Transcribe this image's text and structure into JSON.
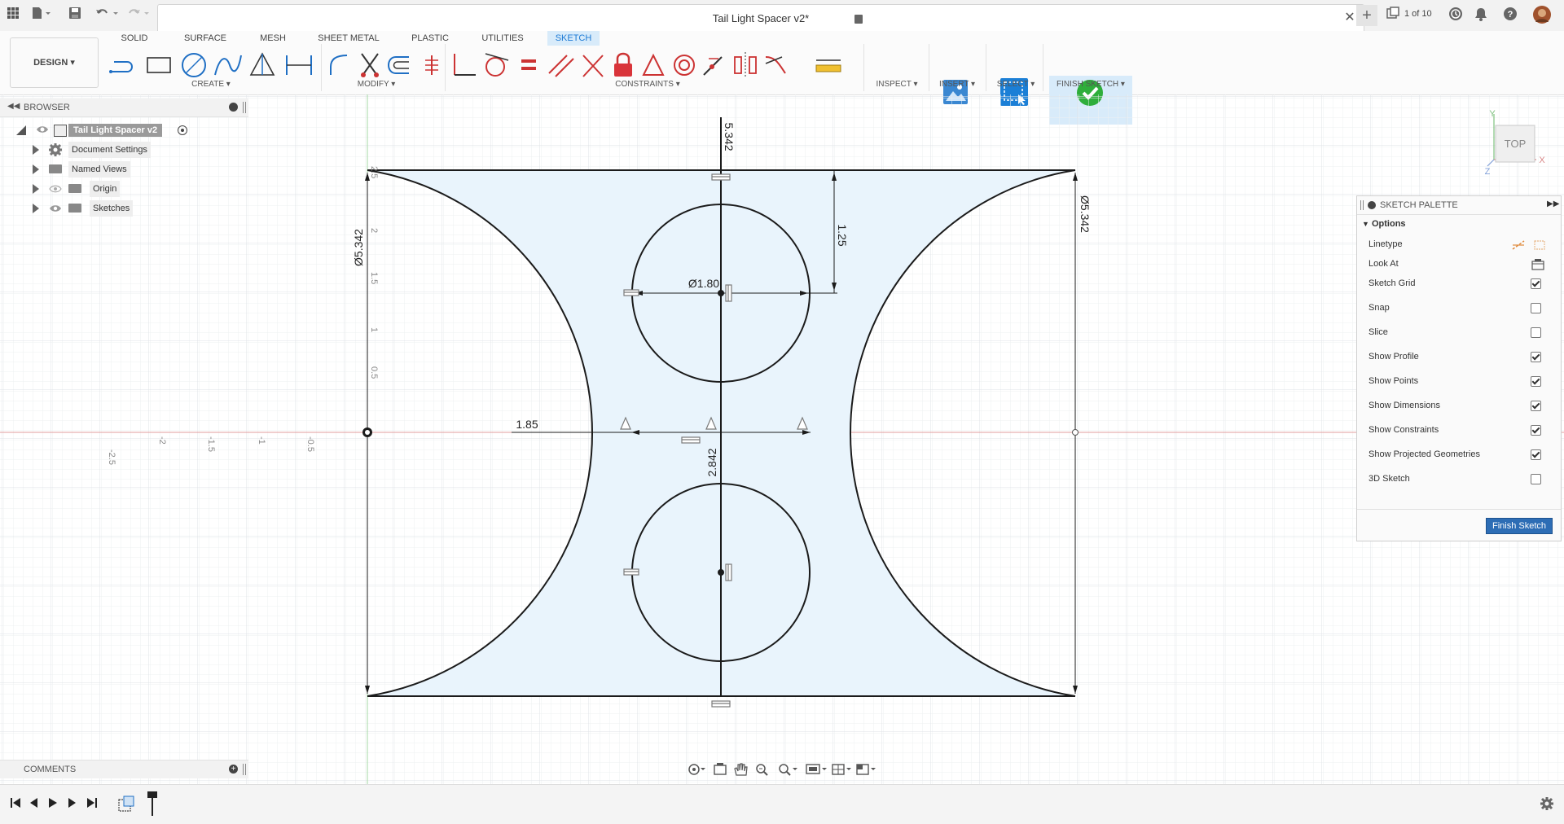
{
  "window": {
    "title": "Tail Light Spacer v2*",
    "version_counter": "1 of 10"
  },
  "ribbon": {
    "workspace": "DESIGN",
    "tabs": [
      "SOLID",
      "SURFACE",
      "MESH",
      "SHEET METAL",
      "PLASTIC",
      "UTILITIES",
      "SKETCH"
    ],
    "active_tab": "SKETCH",
    "groups": {
      "create": "CREATE",
      "modify": "MODIFY",
      "constraints": "CONSTRAINTS",
      "inspect": "INSPECT",
      "insert": "INSERT",
      "select": "SELECT",
      "finish": "FINISH SKETCH"
    }
  },
  "browser": {
    "title": "BROWSER",
    "root": "Tail Light Spacer v2",
    "items": [
      "Document Settings",
      "Named Views",
      "Origin",
      "Sketches"
    ]
  },
  "palette": {
    "title": "SKETCH PALETTE",
    "section": "Options",
    "rows": [
      {
        "label": "Linetype"
      },
      {
        "label": "Look At"
      },
      {
        "label": "Sketch Grid",
        "checked": true
      },
      {
        "label": "Snap",
        "checked": false
      },
      {
        "label": "Slice",
        "checked": false
      },
      {
        "label": "Show Profile",
        "checked": true
      },
      {
        "label": "Show Points",
        "checked": true
      },
      {
        "label": "Show Dimensions",
        "checked": true
      },
      {
        "label": "Show Constraints",
        "checked": true
      },
      {
        "label": "Show Projected Geometries",
        "checked": true
      },
      {
        "label": "3D Sketch",
        "checked": false
      }
    ],
    "finish_button": "Finish Sketch"
  },
  "comments": {
    "title": "COMMENTS"
  },
  "viewcube": {
    "face": "TOP",
    "axis_x": "X",
    "axis_y": "Y",
    "axis_z": "Z"
  },
  "canvas": {
    "dims": {
      "arc_left": "Ø5.342",
      "arc_right": "Ø5.342",
      "top": "5.342",
      "circle": "Ø1.80",
      "offset": "1.25",
      "gap": "1.85",
      "height": "2.842"
    },
    "ruler_x": [
      "-2.5",
      "-2",
      "-1.5",
      "-1",
      "-0.5"
    ],
    "ruler_y": [
      "2.5",
      "2",
      "1.5",
      "1",
      "0.5"
    ]
  },
  "colors": {
    "accent": "#1d7ad5",
    "profile_fill": "#e9f4fc",
    "axis_red": "#e29c9c",
    "axis_green": "#a6d8a6",
    "finish_green": "#2fae3b"
  }
}
